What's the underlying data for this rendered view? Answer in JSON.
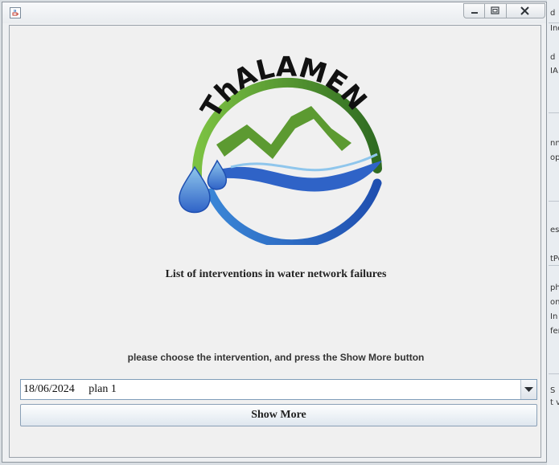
{
  "window": {
    "app_icon": "java-cup-icon",
    "controls": [
      "minimize-icon",
      "maximize-icon",
      "close-icon"
    ]
  },
  "logo": {
    "text": "ThALAMEN",
    "colors": {
      "green_dark": "#2f6b21",
      "green_light": "#7cc242",
      "blue": "#2f63c7",
      "drop": "#3d7fd0"
    }
  },
  "main": {
    "title": "List of interventions in water network failures",
    "instruction": "please choose the intervention, and press the Show More button",
    "selector": {
      "selected": "18/06/2024     plan 1"
    },
    "show_more_label": "Show More"
  },
  "background_window": {
    "fragments": [
      "d",
      "Ind",
      "d",
      "IA",
      "nn",
      "op",
      "esi",
      "tPo",
      "ph",
      "on",
      "In",
      "fer",
      "S",
      "t v"
    ]
  }
}
